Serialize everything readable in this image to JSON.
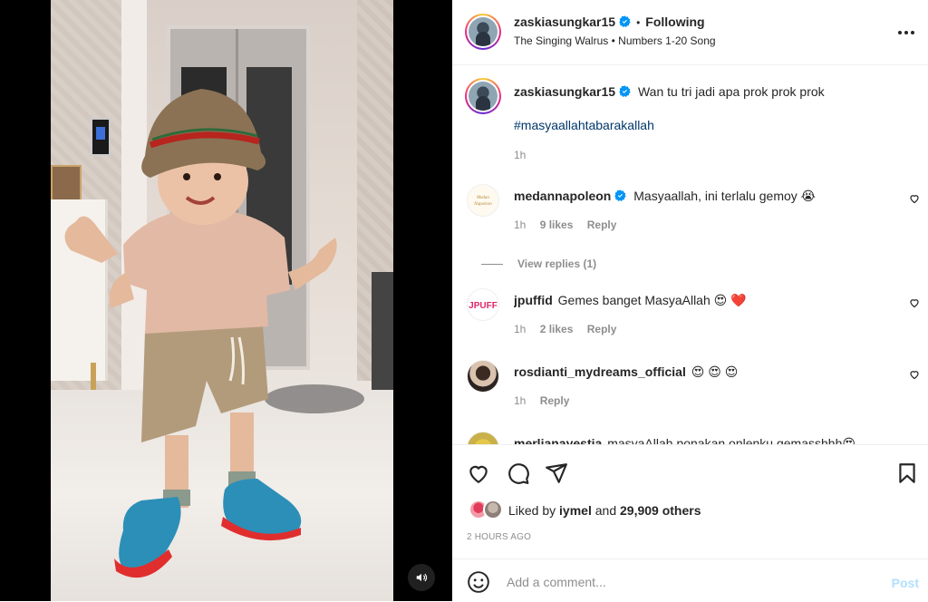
{
  "media": {
    "volume_icon": "speaker-icon"
  },
  "header": {
    "username": "zaskiasungkar15",
    "separator": "•",
    "follow_status": "Following",
    "audio_artist": "The Singing Walrus",
    "audio_sep": "•",
    "audio_title": "Numbers 1-20 Song"
  },
  "caption": {
    "username": "zaskiasungkar15",
    "text": "Wan tu tri jadi apa prok prok prok",
    "hashtag": "#masyaallahtabarakallah",
    "time": "1h"
  },
  "comments": [
    {
      "username": "medannapoleon",
      "verified": true,
      "text": "Masyaallah, ini terlalu gemoy 😭",
      "time": "1h",
      "likes": "9 likes",
      "reply": "Reply",
      "avatar_text": "Medan Napoleon"
    },
    {
      "username": "jpuffid",
      "verified": false,
      "text": "Gemes banget MasyaAllah 😍 ❤️",
      "time": "1h",
      "likes": "2 likes",
      "reply": "Reply",
      "avatar_text": "JPUFF"
    },
    {
      "username": "rosdianti_mydreams_official",
      "verified": false,
      "text": "😍 😍 😍",
      "time": "1h",
      "likes": "",
      "reply": "Reply"
    },
    {
      "username": "merlianayestia",
      "verified": false,
      "text": "masyaAllah ponakan onlenku gemasshhh😍",
      "time": "",
      "likes": "",
      "reply": ""
    }
  ],
  "view_replies": "View replies (1)",
  "likes": {
    "prefix": "Liked by",
    "user": "iymel",
    "and": "and",
    "others": "29,909 others"
  },
  "time_ago": "2 HOURS AGO",
  "add_comment": {
    "placeholder": "Add a comment...",
    "post_label": "Post"
  },
  "colors": {
    "link": "#00376b",
    "verified": "#0095f6",
    "post_disabled": "#b2dffc",
    "muted": "#8e8e8e"
  }
}
